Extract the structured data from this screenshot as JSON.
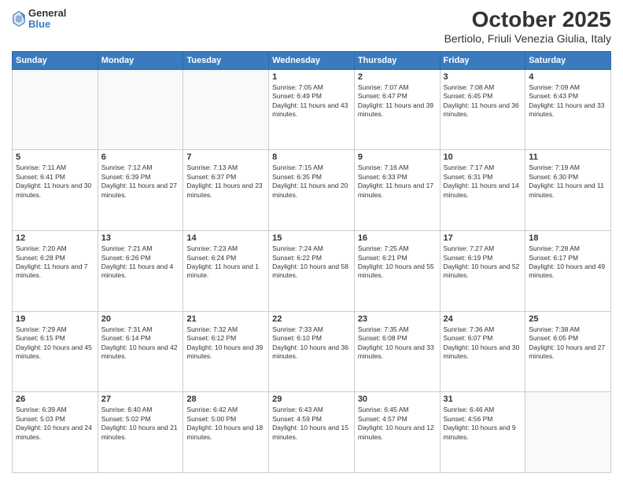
{
  "logo": {
    "general": "General",
    "blue": "Blue"
  },
  "header": {
    "month": "October 2025",
    "location": "Bertiolo, Friuli Venezia Giulia, Italy"
  },
  "weekdays": [
    "Sunday",
    "Monday",
    "Tuesday",
    "Wednesday",
    "Thursday",
    "Friday",
    "Saturday"
  ],
  "weeks": [
    [
      {
        "day": "",
        "sunrise": "",
        "sunset": "",
        "daylight": ""
      },
      {
        "day": "",
        "sunrise": "",
        "sunset": "",
        "daylight": ""
      },
      {
        "day": "",
        "sunrise": "",
        "sunset": "",
        "daylight": ""
      },
      {
        "day": "1",
        "sunrise": "Sunrise: 7:05 AM",
        "sunset": "Sunset: 6:49 PM",
        "daylight": "Daylight: 11 hours and 43 minutes."
      },
      {
        "day": "2",
        "sunrise": "Sunrise: 7:07 AM",
        "sunset": "Sunset: 6:47 PM",
        "daylight": "Daylight: 11 hours and 39 minutes."
      },
      {
        "day": "3",
        "sunrise": "Sunrise: 7:08 AM",
        "sunset": "Sunset: 6:45 PM",
        "daylight": "Daylight: 11 hours and 36 minutes."
      },
      {
        "day": "4",
        "sunrise": "Sunrise: 7:09 AM",
        "sunset": "Sunset: 6:43 PM",
        "daylight": "Daylight: 11 hours and 33 minutes."
      }
    ],
    [
      {
        "day": "5",
        "sunrise": "Sunrise: 7:11 AM",
        "sunset": "Sunset: 6:41 PM",
        "daylight": "Daylight: 11 hours and 30 minutes."
      },
      {
        "day": "6",
        "sunrise": "Sunrise: 7:12 AM",
        "sunset": "Sunset: 6:39 PM",
        "daylight": "Daylight: 11 hours and 27 minutes."
      },
      {
        "day": "7",
        "sunrise": "Sunrise: 7:13 AM",
        "sunset": "Sunset: 6:37 PM",
        "daylight": "Daylight: 11 hours and 23 minutes."
      },
      {
        "day": "8",
        "sunrise": "Sunrise: 7:15 AM",
        "sunset": "Sunset: 6:35 PM",
        "daylight": "Daylight: 11 hours and 20 minutes."
      },
      {
        "day": "9",
        "sunrise": "Sunrise: 7:16 AM",
        "sunset": "Sunset: 6:33 PM",
        "daylight": "Daylight: 11 hours and 17 minutes."
      },
      {
        "day": "10",
        "sunrise": "Sunrise: 7:17 AM",
        "sunset": "Sunset: 6:31 PM",
        "daylight": "Daylight: 11 hours and 14 minutes."
      },
      {
        "day": "11",
        "sunrise": "Sunrise: 7:19 AM",
        "sunset": "Sunset: 6:30 PM",
        "daylight": "Daylight: 11 hours and 11 minutes."
      }
    ],
    [
      {
        "day": "12",
        "sunrise": "Sunrise: 7:20 AM",
        "sunset": "Sunset: 6:28 PM",
        "daylight": "Daylight: 11 hours and 7 minutes."
      },
      {
        "day": "13",
        "sunrise": "Sunrise: 7:21 AM",
        "sunset": "Sunset: 6:26 PM",
        "daylight": "Daylight: 11 hours and 4 minutes."
      },
      {
        "day": "14",
        "sunrise": "Sunrise: 7:23 AM",
        "sunset": "Sunset: 6:24 PM",
        "daylight": "Daylight: 11 hours and 1 minute."
      },
      {
        "day": "15",
        "sunrise": "Sunrise: 7:24 AM",
        "sunset": "Sunset: 6:22 PM",
        "daylight": "Daylight: 10 hours and 58 minutes."
      },
      {
        "day": "16",
        "sunrise": "Sunrise: 7:25 AM",
        "sunset": "Sunset: 6:21 PM",
        "daylight": "Daylight: 10 hours and 55 minutes."
      },
      {
        "day": "17",
        "sunrise": "Sunrise: 7:27 AM",
        "sunset": "Sunset: 6:19 PM",
        "daylight": "Daylight: 10 hours and 52 minutes."
      },
      {
        "day": "18",
        "sunrise": "Sunrise: 7:28 AM",
        "sunset": "Sunset: 6:17 PM",
        "daylight": "Daylight: 10 hours and 49 minutes."
      }
    ],
    [
      {
        "day": "19",
        "sunrise": "Sunrise: 7:29 AM",
        "sunset": "Sunset: 6:15 PM",
        "daylight": "Daylight: 10 hours and 45 minutes."
      },
      {
        "day": "20",
        "sunrise": "Sunrise: 7:31 AM",
        "sunset": "Sunset: 6:14 PM",
        "daylight": "Daylight: 10 hours and 42 minutes."
      },
      {
        "day": "21",
        "sunrise": "Sunrise: 7:32 AM",
        "sunset": "Sunset: 6:12 PM",
        "daylight": "Daylight: 10 hours and 39 minutes."
      },
      {
        "day": "22",
        "sunrise": "Sunrise: 7:33 AM",
        "sunset": "Sunset: 6:10 PM",
        "daylight": "Daylight: 10 hours and 36 minutes."
      },
      {
        "day": "23",
        "sunrise": "Sunrise: 7:35 AM",
        "sunset": "Sunset: 6:08 PM",
        "daylight": "Daylight: 10 hours and 33 minutes."
      },
      {
        "day": "24",
        "sunrise": "Sunrise: 7:36 AM",
        "sunset": "Sunset: 6:07 PM",
        "daylight": "Daylight: 10 hours and 30 minutes."
      },
      {
        "day": "25",
        "sunrise": "Sunrise: 7:38 AM",
        "sunset": "Sunset: 6:05 PM",
        "daylight": "Daylight: 10 hours and 27 minutes."
      }
    ],
    [
      {
        "day": "26",
        "sunrise": "Sunrise: 6:39 AM",
        "sunset": "Sunset: 5:03 PM",
        "daylight": "Daylight: 10 hours and 24 minutes."
      },
      {
        "day": "27",
        "sunrise": "Sunrise: 6:40 AM",
        "sunset": "Sunset: 5:02 PM",
        "daylight": "Daylight: 10 hours and 21 minutes."
      },
      {
        "day": "28",
        "sunrise": "Sunrise: 6:42 AM",
        "sunset": "Sunset: 5:00 PM",
        "daylight": "Daylight: 10 hours and 18 minutes."
      },
      {
        "day": "29",
        "sunrise": "Sunrise: 6:43 AM",
        "sunset": "Sunset: 4:59 PM",
        "daylight": "Daylight: 10 hours and 15 minutes."
      },
      {
        "day": "30",
        "sunrise": "Sunrise: 6:45 AM",
        "sunset": "Sunset: 4:57 PM",
        "daylight": "Daylight: 10 hours and 12 minutes."
      },
      {
        "day": "31",
        "sunrise": "Sunrise: 6:46 AM",
        "sunset": "Sunset: 4:56 PM",
        "daylight": "Daylight: 10 hours and 9 minutes."
      },
      {
        "day": "",
        "sunrise": "",
        "sunset": "",
        "daylight": ""
      }
    ]
  ]
}
